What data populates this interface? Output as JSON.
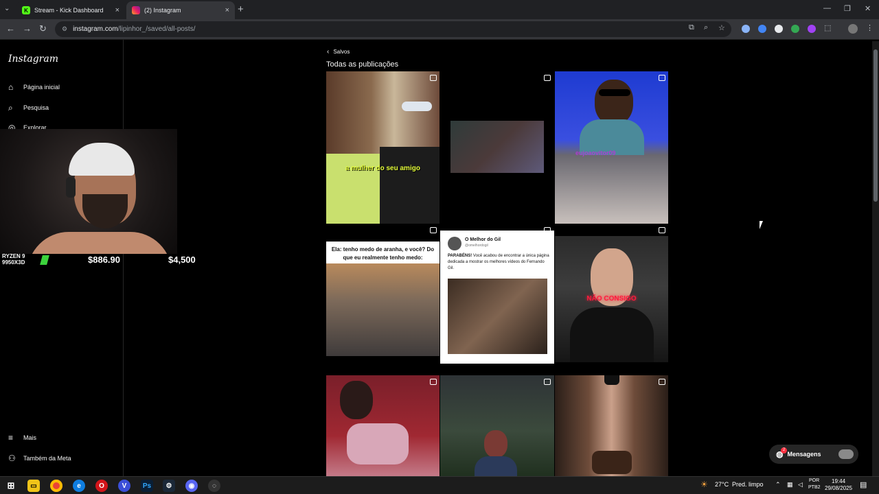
{
  "browser": {
    "tabs": [
      {
        "label": "Stream - Kick Dashboard",
        "active": false
      },
      {
        "label": "(2) Instagram",
        "active": true
      }
    ],
    "url_host": "instagram.com",
    "url_path": "/lipinhor_/saved/all-posts/"
  },
  "sidebar": {
    "logo": "Instagram",
    "items": [
      {
        "label": "Página inicial",
        "icon": "home-icon"
      },
      {
        "label": "Pesquisa",
        "icon": "search-icon"
      },
      {
        "label": "Explorar",
        "icon": "compass-icon"
      }
    ],
    "bottom": [
      {
        "label": "Mais",
        "icon": "menu-icon"
      },
      {
        "label": "Também da Meta",
        "icon": "meta-icon"
      }
    ]
  },
  "overlay": {
    "cpu_line1": "RYZEN 9",
    "cpu_line2": "9950X3D",
    "value1": "$886.90",
    "value2": "$4,500"
  },
  "main": {
    "back_label": "Salvos",
    "title": "Todas as publicações",
    "posts": {
      "p1_caption": "a mulher do seu amigo",
      "p3_caption": "eujoaovitor09",
      "p4_caption": "Ela: tenho medo de aranha, e você? Do que eu realmente tenho medo:",
      "p5_name": "O Melhor do Gil",
      "p5_handle": "@omelhordogil",
      "p5_text_bold": "PARABÉNS!",
      "p5_text": " Você acabou de encontrar a única página dedicada a mostrar os melhores vídeos do Fernando Gil.",
      "p6_caption": "NÃO CONSIGO"
    }
  },
  "messages": {
    "label": "Mensagens",
    "badge": "2"
  },
  "taskbar": {
    "weather_temp": "27°C",
    "weather_desc": "Pred. limpo",
    "lang": "POR",
    "layout": "PTB2",
    "time": "19:44",
    "date": "29/08/2025"
  },
  "colors": {
    "accent_badge": "#ff3040",
    "background": "#000000"
  }
}
